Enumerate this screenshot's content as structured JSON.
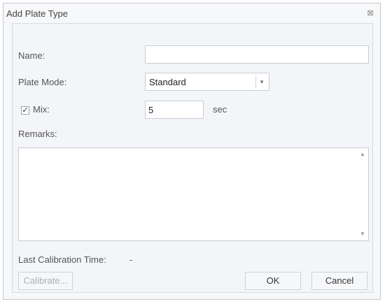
{
  "dialog": {
    "title": "Add Plate Type",
    "close_icon": "close-icon"
  },
  "form": {
    "name_label": "Name:",
    "name_value": "",
    "plate_mode_label": "Plate Mode:",
    "plate_mode_value": "Standard",
    "mix_label": "Mix:",
    "mix_checked": true,
    "mix_value": "5",
    "mix_unit": "sec",
    "remarks_label": "Remarks:",
    "remarks_value": "",
    "last_calibration_label": "Last Calibration Time:",
    "last_calibration_value": "-"
  },
  "buttons": {
    "calibrate": "Calibrate...",
    "ok": "OK",
    "cancel": "Cancel"
  }
}
